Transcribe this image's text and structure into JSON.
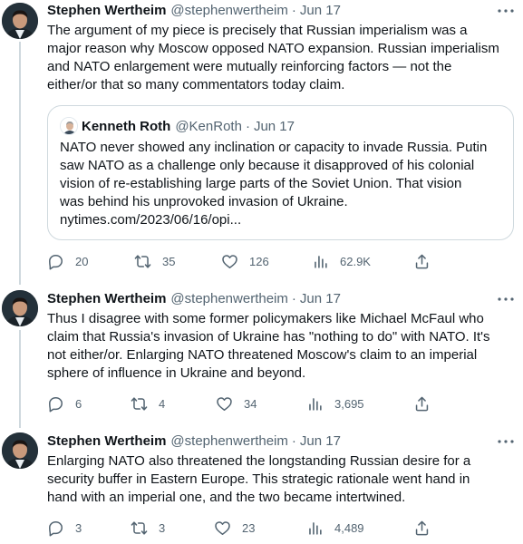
{
  "tweets": [
    {
      "author": "Stephen Wertheim",
      "handle": "@stephenwertheim",
      "sep": "·",
      "date": "Jun 17",
      "text": "The argument of my piece is precisely that Russian imperialism was a\nmajor reason why Moscow opposed NATO expansion. Russian imperialism\nand NATO enlargement were mutually reinforcing factors — not the\neither/or that so many commentators today claim.",
      "quote": {
        "author": "Kenneth Roth",
        "handle": "@KenRoth",
        "sep": "·",
        "date": "Jun 17",
        "text": "NATO never showed any inclination or capacity to invade Russia. Putin\nsaw NATO as a challenge only because it disapproved of his colonial\nvision of re-establishing large parts of the Soviet Union. That vision\nwas behind his unprovoked invasion of Ukraine.\nnytimes.com/2023/06/16/opi..."
      },
      "stats": {
        "replies": "20",
        "retweets": "35",
        "likes": "126",
        "views": "62.9K"
      }
    },
    {
      "author": "Stephen Wertheim",
      "handle": "@stephenwertheim",
      "sep": "·",
      "date": "Jun 17",
      "text": "Thus I disagree with some former policymakers like Michael McFaul who\nclaim that Russia's invasion of Ukraine has \"nothing to do\" with NATO. It's\nnot either/or. Enlarging NATO threatened Moscow's claim to an imperial\nsphere of influence in Ukraine and beyond.",
      "stats": {
        "replies": "6",
        "retweets": "4",
        "likes": "34",
        "views": "3,695"
      }
    },
    {
      "author": "Stephen Wertheim",
      "handle": "@stephenwertheim",
      "sep": "·",
      "date": "Jun 17",
      "text": "Enlarging NATO also threatened the longstanding Russian desire for a\nsecurity buffer in Eastern Europe. This strategic rationale went hand in\nhand with an imperial one, and the two became intertwined.",
      "stats": {
        "replies": "3",
        "retweets": "3",
        "likes": "23",
        "views": "4,489"
      }
    }
  ],
  "icons": {
    "more": "more-icon",
    "reply": "reply-icon",
    "retweet": "retweet-icon",
    "like": "like-icon",
    "views": "views-icon",
    "share": "share-icon"
  },
  "colors": {
    "text": "#0f1419",
    "muted": "#536471",
    "border": "#cfd9de"
  }
}
